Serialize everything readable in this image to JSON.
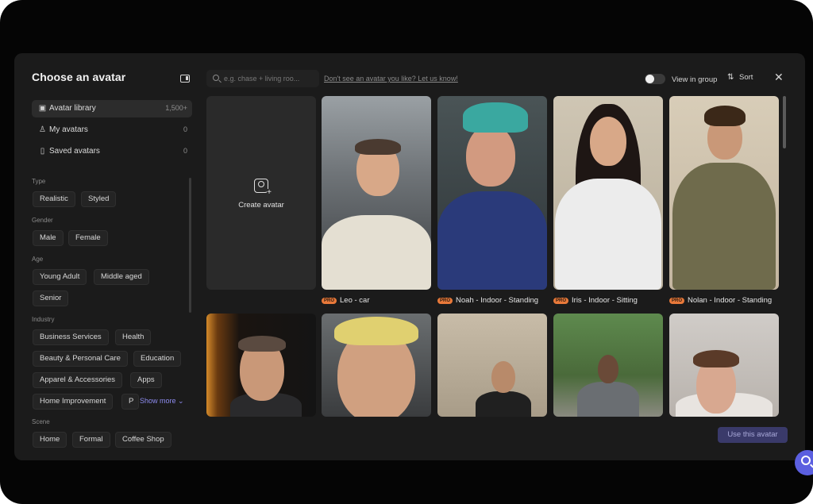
{
  "modal": {
    "title": "Choose an avatar"
  },
  "library": [
    {
      "label": "Avatar library",
      "count": "1,500+",
      "icon": "image-icon"
    },
    {
      "label": "My avatars",
      "count": "0",
      "icon": "user-icon"
    },
    {
      "label": "Saved avatars",
      "count": "0",
      "icon": "bookmark-icon"
    }
  ],
  "filters": {
    "type": {
      "label": "Type",
      "options": [
        "Realistic",
        "Styled"
      ]
    },
    "gender": {
      "label": "Gender",
      "options": [
        "Male",
        "Female"
      ]
    },
    "age": {
      "label": "Age",
      "options": [
        "Young Adult",
        "Middle aged",
        "Senior"
      ]
    },
    "industry": {
      "label": "Industry",
      "options": [
        "Business Services",
        "Health",
        "Beauty & Personal Care",
        "Education",
        "Apparel & Accessories",
        "Apps",
        "Home Improvement",
        "P"
      ]
    },
    "scene": {
      "label": "Scene",
      "options": [
        "Home",
        "Formal",
        "Coffee Shop"
      ]
    },
    "show_more": "Show more"
  },
  "search": {
    "placeholder": "e.g. chase + living roo...",
    "help_link": "Don't see an avatar you like? Let us know!"
  },
  "toolbar": {
    "group_label": "View in group",
    "sort_label": "Sort"
  },
  "create": {
    "label": "Create avatar"
  },
  "avatars": [
    {
      "badge": "PRO",
      "name": "Leo - car"
    },
    {
      "badge": "PRO",
      "name": "Noah - Indoor - Standing"
    },
    {
      "badge": "PRO",
      "name": "Iris - Indoor - Sitting"
    },
    {
      "badge": "PRO",
      "name": "Nolan - Indoor - Standing"
    }
  ],
  "row2_avatars": [
    "presenter-stage",
    "headphones-man",
    "exhibition-woman",
    "outdoor-man",
    "selfie-woman"
  ],
  "cta": {
    "label": "Use this avatar"
  },
  "colors": {
    "accent": "#5b5fe0",
    "pro_badge": "#e8793a",
    "background": "#1b1b1b"
  }
}
